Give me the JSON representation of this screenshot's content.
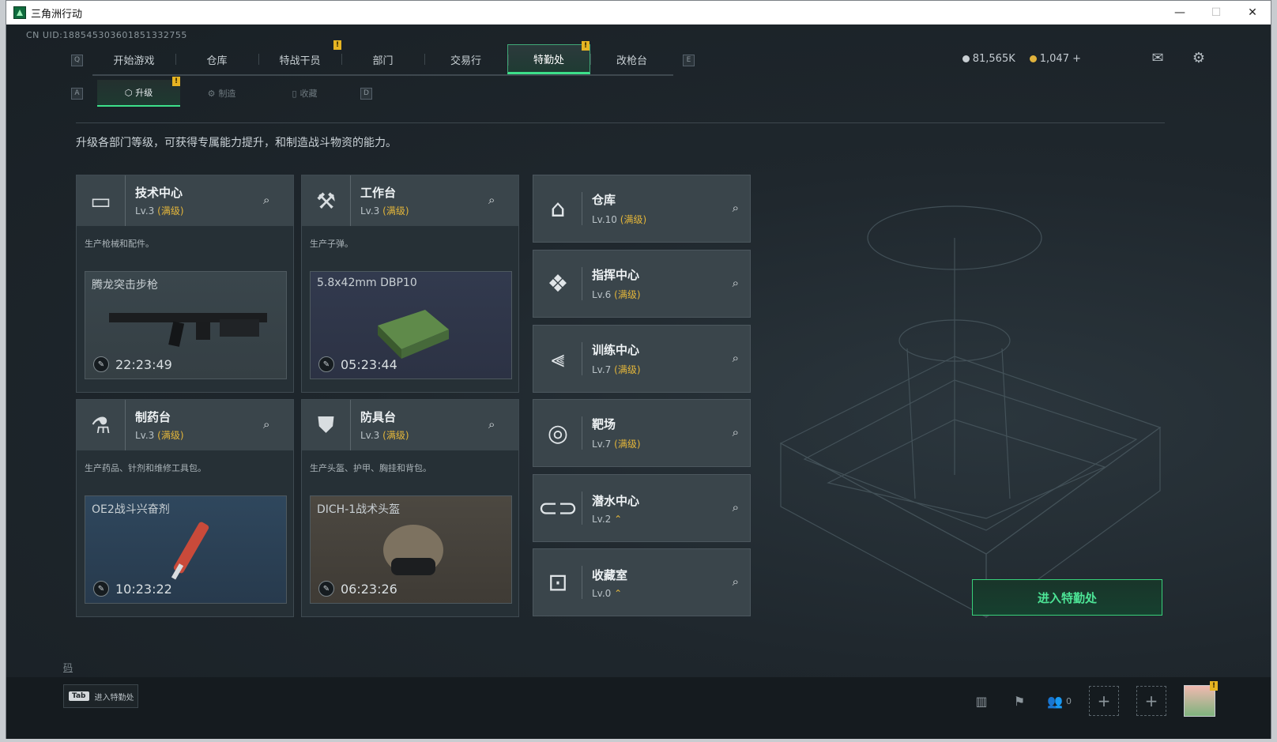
{
  "window": {
    "title": "三角洲行动",
    "min": "—",
    "max": "☐",
    "close": "✕"
  },
  "uid": "CN UID:1885453036018513327​55",
  "nav": {
    "key_left": "Q",
    "key_right": "E",
    "tabs": [
      {
        "label": "开始游戏"
      },
      {
        "label": "仓库"
      },
      {
        "label": "特战干员",
        "badge": "!"
      },
      {
        "label": "部门"
      },
      {
        "label": "交易行"
      },
      {
        "label": "特勤处",
        "badge": "!",
        "active": true
      },
      {
        "label": "改枪台"
      }
    ]
  },
  "currency": {
    "silver": "81,565K",
    "gold": "1,047 +"
  },
  "subnav": {
    "key_left": "A",
    "key_right": "D",
    "tabs": [
      {
        "label": "升级",
        "active": true,
        "badge": "!"
      },
      {
        "label": "制造"
      },
      {
        "label": "收藏"
      }
    ]
  },
  "description": "升级各部门等级，可获得专属能力提升，和制造战斗物资的能力。",
  "facilities": [
    {
      "name": "技术中心",
      "level": "Lv.3",
      "max": "(满级)",
      "desc": "生产枪械和配件。",
      "product": "腾龙突击步枪",
      "timer": "22:23:49",
      "icon": "monitor-icon"
    },
    {
      "name": "工作台",
      "level": "Lv.3",
      "max": "(满级)",
      "desc": "生产子弹。",
      "product": "5.8x42mm DBP10",
      "timer": "05:23:44",
      "icon": "hammer-icon"
    },
    {
      "name": "制药台",
      "level": "Lv.3",
      "max": "(满级)",
      "desc": "生产药品、针剂和维修工具包。",
      "product": "OE2战斗兴奋剂",
      "timer": "10:23:22",
      "icon": "microscope-icon"
    },
    {
      "name": "防具台",
      "level": "Lv.3",
      "max": "(满级)",
      "desc": "生产头盔、护甲、胸挂和背包。",
      "product": "DICH-1战术头盔",
      "timer": "06:23:26",
      "icon": "armor-icon"
    }
  ],
  "small_facilities": [
    {
      "name": "仓库",
      "level": "Lv.10",
      "max": "(满级)",
      "icon": "storage-icon"
    },
    {
      "name": "指挥中心",
      "level": "Lv.6",
      "max": "(满级)",
      "icon": "command-icon"
    },
    {
      "name": "训练中心",
      "level": "Lv.7",
      "max": "(满级)",
      "icon": "dumbbell-icon"
    },
    {
      "name": "靶场",
      "level": "Lv.7",
      "max": "(满级)",
      "icon": "target-icon"
    },
    {
      "name": "潜水中心",
      "level": "Lv.2",
      "up": "⌃",
      "icon": "diving-mask-icon"
    },
    {
      "name": "收藏室",
      "level": "Lv.0",
      "up": "⌃",
      "icon": "collection-icon"
    }
  ],
  "enter_button": "进入特勤处",
  "bottom": {
    "tab_key": "Tab",
    "tab_label": "进入特勤处",
    "code": "码",
    "friends": "0"
  }
}
